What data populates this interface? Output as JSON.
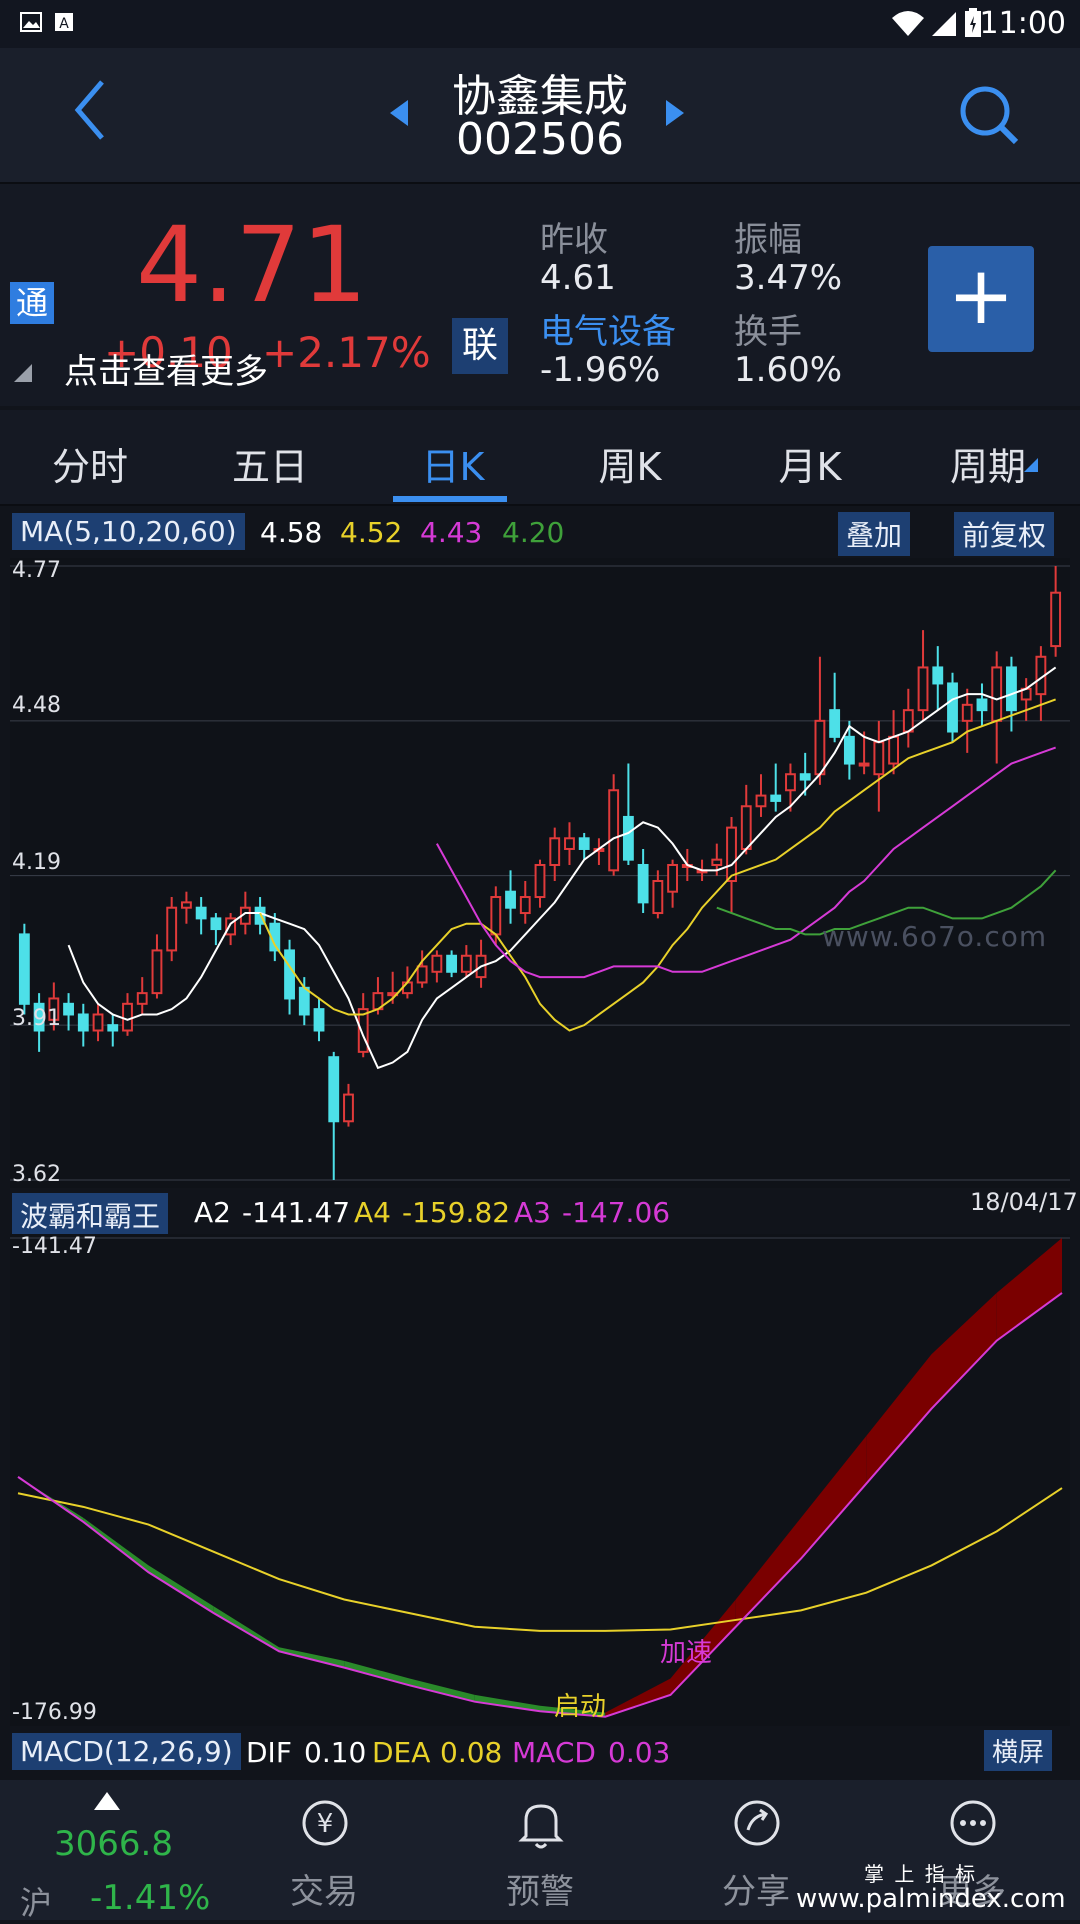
{
  "status_bar": {
    "time": "11:00"
  },
  "header": {
    "stock_name": "协鑫集成",
    "stock_code": "002506"
  },
  "quote": {
    "price": "4.71",
    "change": "+0.10",
    "change_pct": "+2.17%",
    "tong_badge": "通",
    "lian_badge": "联",
    "more_hint": "点击查看更多",
    "prev_close_label": "昨收",
    "prev_close": "4.61",
    "amplitude_label": "振幅",
    "amplitude": "3.47%",
    "sector_label": "电气设备",
    "sector_change": "-1.96%",
    "turnover_label": "换手",
    "turnover": "1.60%",
    "add_symbol": "+"
  },
  "tabs": [
    {
      "label": "分时"
    },
    {
      "label": "五日"
    },
    {
      "label": "日K"
    },
    {
      "label": "周K"
    },
    {
      "label": "月K"
    },
    {
      "label": "周期"
    }
  ],
  "ma_bar": {
    "label": "MA(5,10,20,60)",
    "ma5": "4.58",
    "ma10": "4.52",
    "ma20": "4.43",
    "ma60": "4.20",
    "overlay_button": "叠加",
    "adjust_button": "前复权"
  },
  "price_axis": [
    "4.77",
    "4.48",
    "4.19",
    "3.91",
    "3.62"
  ],
  "watermark": "www.6o7o.com",
  "indicator_bar": {
    "name": "波霸和霸王",
    "a2_label": "A2",
    "a2": "-141.47",
    "a4_label": "A4",
    "a4": "-159.82",
    "a3_label": "A3",
    "a3": "-147.06",
    "date": "18/04/17"
  },
  "indicator_axis": {
    "top": "-141.47",
    "bottom": "-176.99"
  },
  "indicator_annotations": {
    "start": "启动",
    "accelerate": "加速"
  },
  "macd_bar": {
    "label": "MACD(12,26,9)",
    "dif_label": "DIF",
    "dif": "0.10",
    "dea_label": "DEA",
    "dea": "0.08",
    "macd_label": "MACD",
    "macd": "0.03",
    "landscape_button": "横屏"
  },
  "bottom_nav": {
    "index_value": "3066.8",
    "index_name": "沪",
    "index_change": "-1.41%",
    "items": [
      {
        "label": "交易"
      },
      {
        "label": "预警"
      },
      {
        "label": "分享"
      },
      {
        "label": "更多"
      }
    ]
  },
  "footer_brand": {
    "top": "掌 上 指 标",
    "url": "www.palmindex.com"
  },
  "colors": {
    "up": "#e03a3a",
    "down": "#4de0e8",
    "ma5": "#ffffff",
    "ma10": "#e8d12a",
    "ma20": "#d63ad6",
    "ma60": "#3fa13a",
    "accent": "#3b8ff0",
    "green_band": "#2a8a2a",
    "red_band": "#7a0000"
  },
  "chart_data": [
    {
      "type": "candlestick",
      "title": "",
      "ylim": [
        3.62,
        4.77
      ],
      "y_ticks": [
        4.77,
        4.48,
        4.19,
        3.91,
        3.62
      ],
      "candles": [
        [
          4.08,
          3.95,
          4.1,
          3.93
        ],
        [
          3.95,
          3.9,
          3.97,
          3.86
        ],
        [
          3.92,
          3.96,
          3.99,
          3.9
        ],
        [
          3.95,
          3.93,
          3.97,
          3.9
        ],
        [
          3.93,
          3.9,
          3.95,
          3.87
        ],
        [
          3.9,
          3.93,
          3.95,
          3.88
        ],
        [
          3.91,
          3.9,
          3.93,
          3.87
        ],
        [
          3.9,
          3.95,
          3.97,
          3.89
        ],
        [
          3.95,
          3.97,
          4.0,
          3.93
        ],
        [
          3.97,
          4.05,
          4.08,
          3.96
        ],
        [
          4.05,
          4.13,
          4.15,
          4.03
        ],
        [
          4.13,
          4.14,
          4.16,
          4.1
        ],
        [
          4.13,
          4.11,
          4.15,
          4.08
        ],
        [
          4.11,
          4.09,
          4.12,
          4.06
        ],
        [
          4.08,
          4.11,
          4.12,
          4.06
        ],
        [
          4.1,
          4.13,
          4.16,
          4.08
        ],
        [
          4.13,
          4.1,
          4.15,
          4.08
        ],
        [
          4.1,
          4.05,
          4.12,
          4.03
        ],
        [
          4.05,
          3.96,
          4.07,
          3.93
        ],
        [
          3.98,
          3.93,
          4.0,
          3.91
        ],
        [
          3.94,
          3.9,
          3.96,
          3.88
        ],
        [
          3.85,
          3.73,
          3.86,
          3.62
        ],
        [
          3.73,
          3.78,
          3.8,
          3.72
        ],
        [
          3.86,
          3.94,
          3.97,
          3.85
        ],
        [
          3.94,
          3.97,
          4.0,
          3.93
        ],
        [
          3.97,
          3.97,
          4.01,
          3.95
        ],
        [
          3.97,
          3.99,
          4.02,
          3.96
        ],
        [
          3.99,
          4.02,
          4.05,
          3.98
        ],
        [
          4.01,
          4.04,
          4.05,
          3.99
        ],
        [
          4.04,
          4.01,
          4.05,
          4.0
        ],
        [
          4.01,
          4.04,
          4.06,
          4.0
        ],
        [
          4.0,
          4.04,
          4.07,
          3.98
        ],
        [
          4.08,
          4.15,
          4.17,
          4.06
        ],
        [
          4.16,
          4.13,
          4.2,
          4.1
        ],
        [
          4.12,
          4.15,
          4.18,
          4.1
        ],
        [
          4.15,
          4.21,
          4.22,
          4.13
        ],
        [
          4.21,
          4.26,
          4.28,
          4.18
        ],
        [
          4.24,
          4.26,
          4.29,
          4.21
        ],
        [
          4.26,
          4.24,
          4.27,
          4.22
        ],
        [
          4.24,
          4.24,
          4.26,
          4.21
        ],
        [
          4.2,
          4.35,
          4.38,
          4.19
        ],
        [
          4.3,
          4.22,
          4.4,
          4.21
        ],
        [
          4.21,
          4.14,
          4.24,
          4.12
        ],
        [
          4.12,
          4.18,
          4.2,
          4.11
        ],
        [
          4.16,
          4.21,
          4.22,
          4.13
        ],
        [
          4.21,
          4.21,
          4.24,
          4.18
        ],
        [
          4.2,
          4.2,
          4.22,
          4.18
        ],
        [
          4.21,
          4.22,
          4.25,
          4.19
        ],
        [
          4.18,
          4.28,
          4.3,
          4.12
        ],
        [
          4.24,
          4.32,
          4.36,
          4.23
        ],
        [
          4.32,
          4.34,
          4.38,
          4.3
        ],
        [
          4.34,
          4.33,
          4.4,
          4.31
        ],
        [
          4.35,
          4.38,
          4.4,
          4.31
        ],
        [
          4.38,
          4.37,
          4.42,
          4.34
        ],
        [
          4.38,
          4.48,
          4.6,
          4.36
        ],
        [
          4.5,
          4.45,
          4.57,
          4.44
        ],
        [
          4.45,
          4.4,
          4.48,
          4.37
        ],
        [
          4.4,
          4.4,
          4.46,
          4.38
        ],
        [
          4.38,
          4.44,
          4.48,
          4.31
        ],
        [
          4.4,
          4.45,
          4.5,
          4.38
        ],
        [
          4.46,
          4.5,
          4.54,
          4.43
        ],
        [
          4.5,
          4.58,
          4.65,
          4.48
        ],
        [
          4.58,
          4.55,
          4.62,
          4.5
        ],
        [
          4.55,
          4.46,
          4.57,
          4.44
        ],
        [
          4.48,
          4.51,
          4.54,
          4.42
        ],
        [
          4.52,
          4.5,
          4.55,
          4.47
        ],
        [
          4.48,
          4.58,
          4.61,
          4.4
        ],
        [
          4.58,
          4.5,
          4.6,
          4.46
        ],
        [
          4.52,
          4.54,
          4.56,
          4.48
        ],
        [
          4.53,
          4.6,
          4.62,
          4.48
        ],
        [
          4.62,
          4.72,
          4.77,
          4.6
        ]
      ],
      "ma": {
        "MA5": [
          4.06,
          3.99,
          3.95,
          3.93,
          3.92,
          3.93,
          3.93,
          3.94,
          3.96,
          4.0,
          4.05,
          4.1,
          4.12,
          4.12,
          4.11,
          4.1,
          4.09,
          4.06,
          4.01,
          3.96,
          3.89,
          3.83,
          3.84,
          3.86,
          3.92,
          3.96,
          3.98,
          4.0,
          4.02,
          4.03,
          4.05,
          4.08,
          4.11,
          4.14,
          4.18,
          4.22,
          4.24,
          4.26,
          4.27,
          4.29,
          4.28,
          4.25,
          4.21,
          4.2,
          4.2,
          4.21,
          4.24,
          4.27,
          4.3,
          4.32,
          4.35,
          4.38,
          4.42,
          4.47,
          4.45,
          4.44,
          4.45,
          4.46,
          4.48,
          4.5,
          4.52,
          4.53,
          4.53,
          4.52,
          4.53,
          4.54,
          4.56,
          4.58
        ],
        "MA10": [
          4.12,
          4.06,
          4.02,
          3.98,
          3.96,
          3.94,
          3.93,
          3.93,
          3.94,
          3.96,
          3.99,
          4.03,
          4.06,
          4.09,
          4.1,
          4.1,
          4.08,
          4.04,
          4.0,
          3.95,
          3.92,
          3.9,
          3.91,
          3.93,
          3.95,
          3.97,
          3.99,
          4.02,
          4.06,
          4.09,
          4.13,
          4.16,
          4.19,
          4.2,
          4.21,
          4.22,
          4.24,
          4.26,
          4.28,
          4.31,
          4.33,
          4.35,
          4.37,
          4.39,
          4.41,
          4.42,
          4.43,
          4.44,
          4.46,
          4.47,
          4.48,
          4.49,
          4.5,
          4.51,
          4.52
        ],
        "MA20": [
          4.25,
          4.2,
          4.15,
          4.1,
          4.06,
          4.03,
          4.01,
          4.0,
          4.0,
          4.0,
          4.0,
          4.01,
          4.02,
          4.02,
          4.02,
          4.02,
          4.01,
          4.01,
          4.01,
          4.02,
          4.03,
          4.04,
          4.05,
          4.06,
          4.07,
          4.09,
          4.11,
          4.13,
          4.16,
          4.18,
          4.21,
          4.24,
          4.26,
          4.28,
          4.3,
          4.32,
          4.34,
          4.36,
          4.38,
          4.4,
          4.41,
          4.42,
          4.43
        ],
        "MA60": [
          4.13,
          4.12,
          4.11,
          4.1,
          4.09,
          4.09,
          4.08,
          4.08,
          4.09,
          4.09,
          4.1,
          4.11,
          4.12,
          4.13,
          4.13,
          4.12,
          4.11,
          4.11,
          4.11,
          4.12,
          4.13,
          4.15,
          4.17,
          4.2
        ]
      }
    },
    {
      "type": "area",
      "title": "波霸和霸王",
      "ylim": [
        -176.99,
        -141.47
      ],
      "series": [
        {
          "name": "A2",
          "values": [
            -159.0,
            -162.0,
            -165.5,
            -168.5,
            -171.5,
            -172.5,
            -173.8,
            -175.0,
            -175.8,
            -176.3,
            -173.8,
            -168.0,
            -162.0,
            -156.0,
            -150.0,
            -145.5,
            -141.47
          ]
        },
        {
          "name": "A3",
          "values": [
            -159.0,
            -162.3,
            -166.0,
            -169.0,
            -171.8,
            -173.0,
            -174.3,
            -175.5,
            -176.2,
            -176.6,
            -175.0,
            -170.0,
            -165.0,
            -159.5,
            -154.0,
            -149.0,
            -145.5
          ]
        },
        {
          "name": "A4",
          "values": [
            -160.2,
            -161.2,
            -162.5,
            -164.5,
            -166.5,
            -168.0,
            -169.0,
            -170.0,
            -170.3,
            -170.3,
            -170.2,
            -169.5,
            -168.8,
            -167.5,
            -165.5,
            -163.0,
            -159.82
          ]
        }
      ],
      "annotations": [
        "启动",
        "加速"
      ]
    }
  ]
}
